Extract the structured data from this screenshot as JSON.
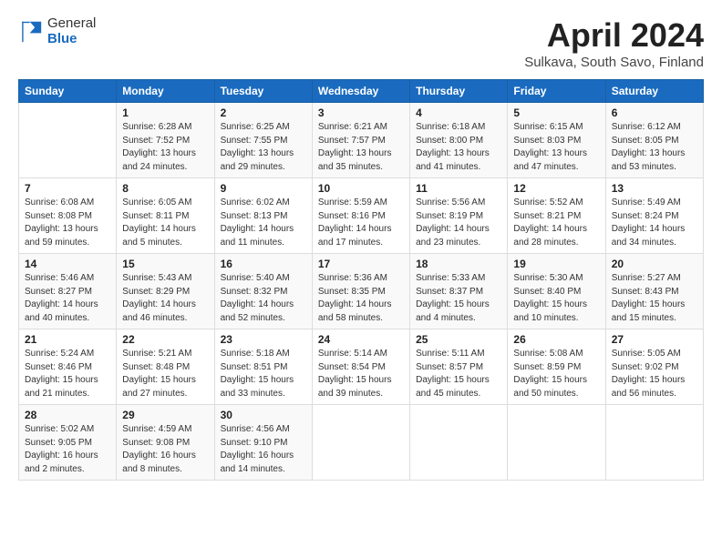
{
  "header": {
    "logo_general": "General",
    "logo_blue": "Blue",
    "title": "April 2024",
    "subtitle": "Sulkava, South Savo, Finland"
  },
  "weekdays": [
    "Sunday",
    "Monday",
    "Tuesday",
    "Wednesday",
    "Thursday",
    "Friday",
    "Saturday"
  ],
  "weeks": [
    [
      {
        "day": "",
        "info": ""
      },
      {
        "day": "1",
        "info": "Sunrise: 6:28 AM\nSunset: 7:52 PM\nDaylight: 13 hours\nand 24 minutes."
      },
      {
        "day": "2",
        "info": "Sunrise: 6:25 AM\nSunset: 7:55 PM\nDaylight: 13 hours\nand 29 minutes."
      },
      {
        "day": "3",
        "info": "Sunrise: 6:21 AM\nSunset: 7:57 PM\nDaylight: 13 hours\nand 35 minutes."
      },
      {
        "day": "4",
        "info": "Sunrise: 6:18 AM\nSunset: 8:00 PM\nDaylight: 13 hours\nand 41 minutes."
      },
      {
        "day": "5",
        "info": "Sunrise: 6:15 AM\nSunset: 8:03 PM\nDaylight: 13 hours\nand 47 minutes."
      },
      {
        "day": "6",
        "info": "Sunrise: 6:12 AM\nSunset: 8:05 PM\nDaylight: 13 hours\nand 53 minutes."
      }
    ],
    [
      {
        "day": "7",
        "info": "Sunrise: 6:08 AM\nSunset: 8:08 PM\nDaylight: 13 hours\nand 59 minutes."
      },
      {
        "day": "8",
        "info": "Sunrise: 6:05 AM\nSunset: 8:11 PM\nDaylight: 14 hours\nand 5 minutes."
      },
      {
        "day": "9",
        "info": "Sunrise: 6:02 AM\nSunset: 8:13 PM\nDaylight: 14 hours\nand 11 minutes."
      },
      {
        "day": "10",
        "info": "Sunrise: 5:59 AM\nSunset: 8:16 PM\nDaylight: 14 hours\nand 17 minutes."
      },
      {
        "day": "11",
        "info": "Sunrise: 5:56 AM\nSunset: 8:19 PM\nDaylight: 14 hours\nand 23 minutes."
      },
      {
        "day": "12",
        "info": "Sunrise: 5:52 AM\nSunset: 8:21 PM\nDaylight: 14 hours\nand 28 minutes."
      },
      {
        "day": "13",
        "info": "Sunrise: 5:49 AM\nSunset: 8:24 PM\nDaylight: 14 hours\nand 34 minutes."
      }
    ],
    [
      {
        "day": "14",
        "info": "Sunrise: 5:46 AM\nSunset: 8:27 PM\nDaylight: 14 hours\nand 40 minutes."
      },
      {
        "day": "15",
        "info": "Sunrise: 5:43 AM\nSunset: 8:29 PM\nDaylight: 14 hours\nand 46 minutes."
      },
      {
        "day": "16",
        "info": "Sunrise: 5:40 AM\nSunset: 8:32 PM\nDaylight: 14 hours\nand 52 minutes."
      },
      {
        "day": "17",
        "info": "Sunrise: 5:36 AM\nSunset: 8:35 PM\nDaylight: 14 hours\nand 58 minutes."
      },
      {
        "day": "18",
        "info": "Sunrise: 5:33 AM\nSunset: 8:37 PM\nDaylight: 15 hours\nand 4 minutes."
      },
      {
        "day": "19",
        "info": "Sunrise: 5:30 AM\nSunset: 8:40 PM\nDaylight: 15 hours\nand 10 minutes."
      },
      {
        "day": "20",
        "info": "Sunrise: 5:27 AM\nSunset: 8:43 PM\nDaylight: 15 hours\nand 15 minutes."
      }
    ],
    [
      {
        "day": "21",
        "info": "Sunrise: 5:24 AM\nSunset: 8:46 PM\nDaylight: 15 hours\nand 21 minutes."
      },
      {
        "day": "22",
        "info": "Sunrise: 5:21 AM\nSunset: 8:48 PM\nDaylight: 15 hours\nand 27 minutes."
      },
      {
        "day": "23",
        "info": "Sunrise: 5:18 AM\nSunset: 8:51 PM\nDaylight: 15 hours\nand 33 minutes."
      },
      {
        "day": "24",
        "info": "Sunrise: 5:14 AM\nSunset: 8:54 PM\nDaylight: 15 hours\nand 39 minutes."
      },
      {
        "day": "25",
        "info": "Sunrise: 5:11 AM\nSunset: 8:57 PM\nDaylight: 15 hours\nand 45 minutes."
      },
      {
        "day": "26",
        "info": "Sunrise: 5:08 AM\nSunset: 8:59 PM\nDaylight: 15 hours\nand 50 minutes."
      },
      {
        "day": "27",
        "info": "Sunrise: 5:05 AM\nSunset: 9:02 PM\nDaylight: 15 hours\nand 56 minutes."
      }
    ],
    [
      {
        "day": "28",
        "info": "Sunrise: 5:02 AM\nSunset: 9:05 PM\nDaylight: 16 hours\nand 2 minutes."
      },
      {
        "day": "29",
        "info": "Sunrise: 4:59 AM\nSunset: 9:08 PM\nDaylight: 16 hours\nand 8 minutes."
      },
      {
        "day": "30",
        "info": "Sunrise: 4:56 AM\nSunset: 9:10 PM\nDaylight: 16 hours\nand 14 minutes."
      },
      {
        "day": "",
        "info": ""
      },
      {
        "day": "",
        "info": ""
      },
      {
        "day": "",
        "info": ""
      },
      {
        "day": "",
        "info": ""
      }
    ]
  ]
}
